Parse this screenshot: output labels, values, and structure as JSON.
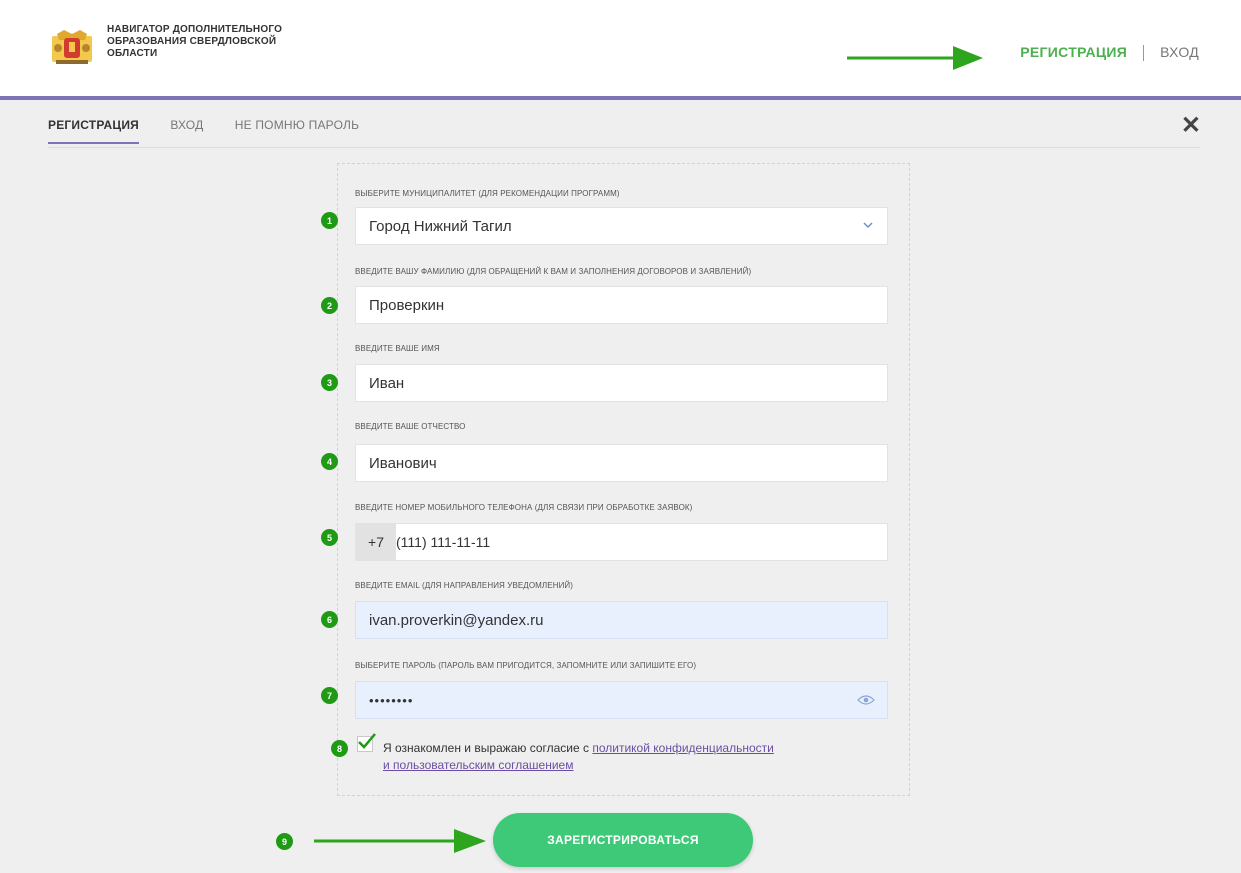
{
  "header": {
    "brand_line1": "НАВИГАТОР ДОПОЛНИТЕЛЬНОГО",
    "brand_line2": "ОБРАЗОВАНИЯ СВЕРДЛОВСКОЙ",
    "brand_line3": "ОБЛАСТИ",
    "register_link": "РЕГИСТРАЦИЯ",
    "login_link": "ВХОД"
  },
  "tabs": [
    {
      "label": "РЕГИСТРАЦИЯ",
      "active": true
    },
    {
      "label": "ВХОД",
      "active": false
    },
    {
      "label": "НЕ ПОМНЮ ПАРОЛЬ",
      "active": false
    }
  ],
  "close_icon": "✕",
  "form": {
    "municipality": {
      "badge": "1",
      "label": "Выберите муниципалитет (для рекомендации программ)",
      "value": "Город Нижний Тагил"
    },
    "surname": {
      "badge": "2",
      "label": "Введите вашу фамилию (для обращений к вам и заполнения договоров и заявлений)",
      "value": "Проверкин"
    },
    "name": {
      "badge": "3",
      "label": "Введите ваше имя",
      "value": "Иван"
    },
    "patronymic": {
      "badge": "4",
      "label": "Введите ваше отчество",
      "value": "Иванович"
    },
    "phone": {
      "badge": "5",
      "label": "Введите номер мобильного телефона (для связи при обработке заявок)",
      "prefix": "+7",
      "value": "(111) 111-11-11"
    },
    "email": {
      "badge": "6",
      "label": "Введите email (для направления уведомлений)",
      "value": "ivan.proverkin@yandex.ru"
    },
    "password": {
      "badge": "7",
      "label": "Выберите пароль (пароль вам пригодится, запомните или запишите его)",
      "value": "••••••••"
    },
    "consent": {
      "badge": "8",
      "text": "Я ознакомлен и выражаю согласие с ",
      "link1": "политикой конфиденциальности",
      "link2": "и пользовательским соглашением",
      "checked": true
    },
    "submit": {
      "badge": "9",
      "label": "ЗАРЕГИСТРИРОВАТЬСЯ"
    }
  },
  "colors": {
    "accent": "#7d74b6",
    "green": "#4caf50",
    "badge": "#1f9a14",
    "button": "#3ec979",
    "arrow": "#2ea51f"
  }
}
